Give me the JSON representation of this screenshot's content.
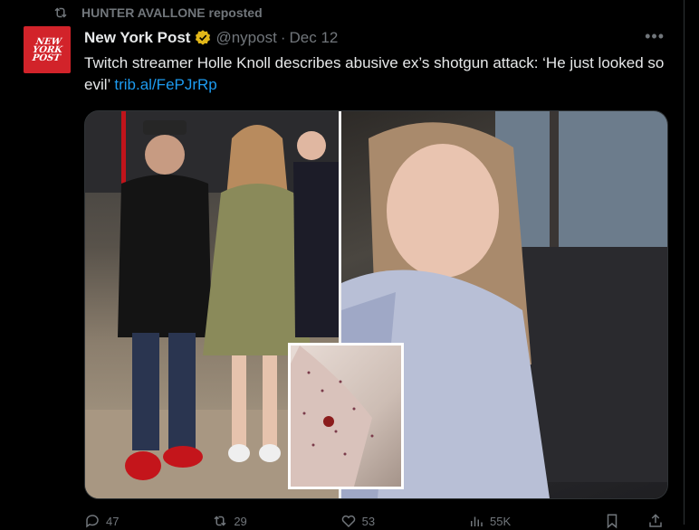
{
  "repost": {
    "label": "HUNTER AVALLONE reposted"
  },
  "author": {
    "name": "New York Post",
    "handle": "@nypost",
    "date": "Dec 12",
    "avatar_text": "NEW YORK POST",
    "verified_badge_color": "#e2b719"
  },
  "tweet": {
    "text": "Twitch streamer Holle Knoll describes abusive ex’s shotgun attack: ‘He just looked so evil’",
    "link": "trib.al/FePJrRp"
  },
  "actions": {
    "replies": "47",
    "reposts": "29",
    "likes": "53",
    "views": "55K"
  },
  "colors": {
    "background": "#000000",
    "text": "#e7e9ea",
    "muted": "#71767b",
    "link": "#1d9bf0",
    "brand_red": "#d2232a"
  }
}
